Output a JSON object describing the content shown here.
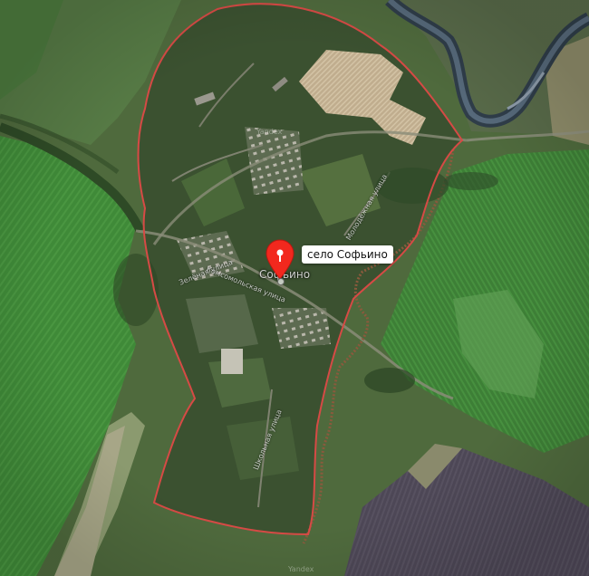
{
  "map": {
    "type": "satellite",
    "place_name": "село Софьино",
    "village_label": "Софьино",
    "boundary_color": "#d64a45",
    "pin_color": "#f2281e"
  },
  "streets": [
    "Зелёная улица",
    "Комсомольская улица",
    "Школьная улица",
    "Молодёжная улица"
  ],
  "watermarks": [
    "Yandex",
    "Yandex"
  ]
}
